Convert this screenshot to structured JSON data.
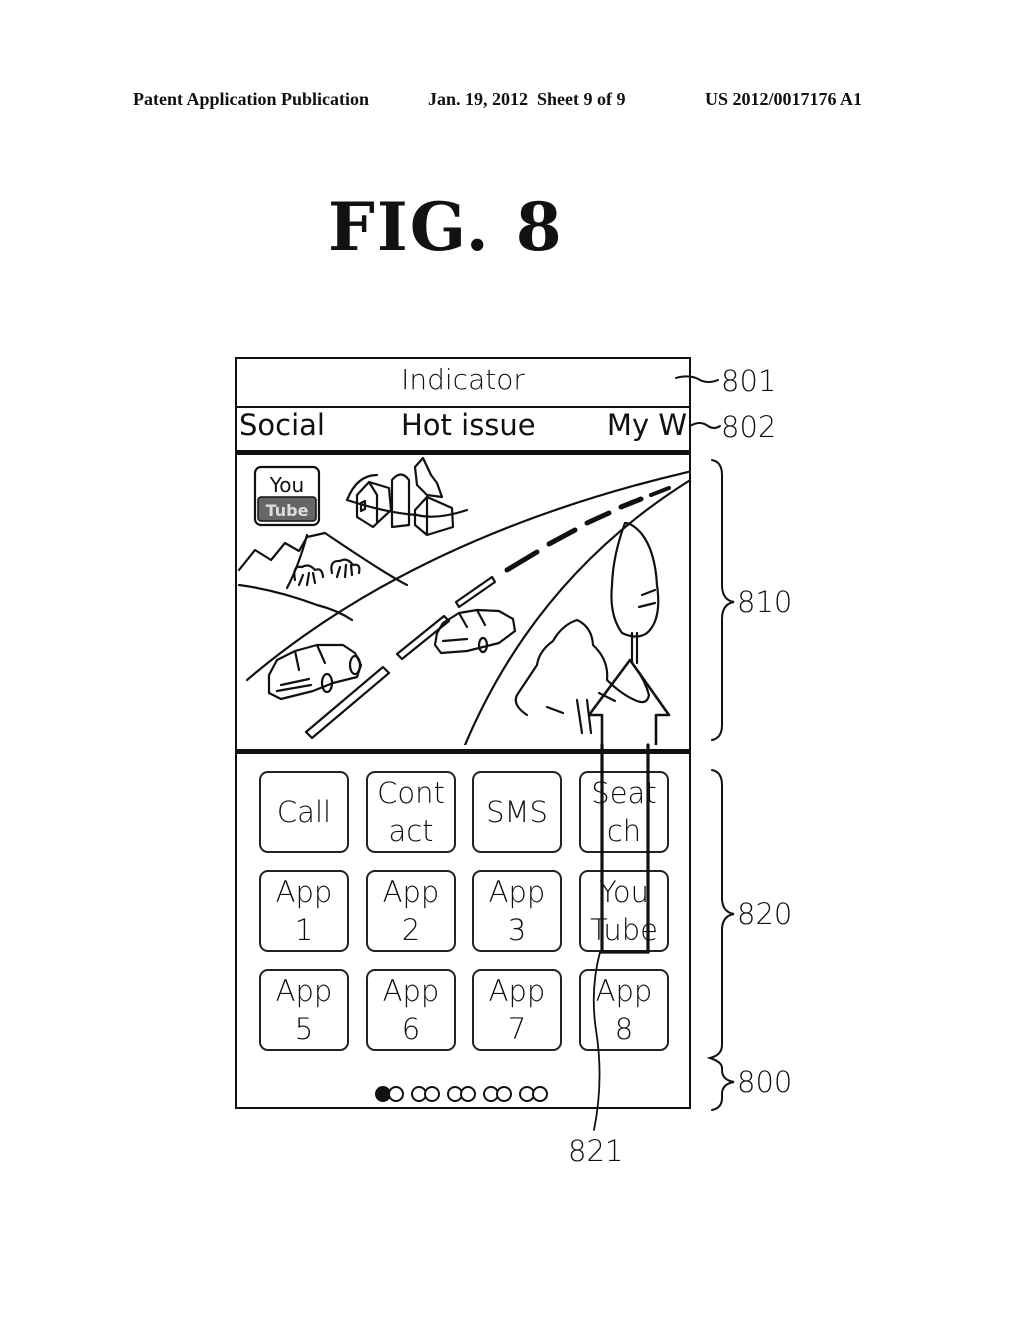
{
  "header": {
    "publication": "Patent Application Publication",
    "date": "Jan. 19, 2012",
    "sheet": "Sheet 9 of 9",
    "number": "US 2012/0017176 A1"
  },
  "figure": {
    "title": "FIG. 8"
  },
  "device": {
    "indicator_label": "Indicator",
    "tabs": [
      {
        "label": "Social"
      },
      {
        "label": "Hot issue",
        "selected": true
      },
      {
        "label": "My W"
      }
    ],
    "content": {
      "description": "Illustration of a road with two cars, farmhouse with silo, hills, bushes and trees",
      "widget_icon": {
        "line1": "You",
        "line2": "Tube"
      }
    },
    "apps": [
      {
        "line1": "Call",
        "line2": ""
      },
      {
        "line1": "Cont",
        "line2": "act"
      },
      {
        "line1": "SMS",
        "line2": ""
      },
      {
        "line1": "Seat",
        "line2": "ch"
      },
      {
        "line1": "App",
        "line2": "1"
      },
      {
        "line1": "App",
        "line2": "2"
      },
      {
        "line1": "App",
        "line2": "3"
      },
      {
        "line1": "You",
        "line2": "Tube"
      },
      {
        "line1": "App",
        "line2": "5"
      },
      {
        "line1": "App",
        "line2": "6"
      },
      {
        "line1": "App",
        "line2": "7"
      },
      {
        "line1": "App",
        "line2": "8"
      }
    ],
    "page_indicator": {
      "pages": 5,
      "current": 1
    },
    "drag_gesture": {
      "icon": "up-arrow",
      "from": "YouTube icon",
      "to": "content area"
    }
  },
  "reference_numerals": {
    "indicator": "801",
    "tab_bar": "802",
    "content_area": "810",
    "app_grid": "820",
    "device": "800",
    "drag_arrow": "821"
  }
}
